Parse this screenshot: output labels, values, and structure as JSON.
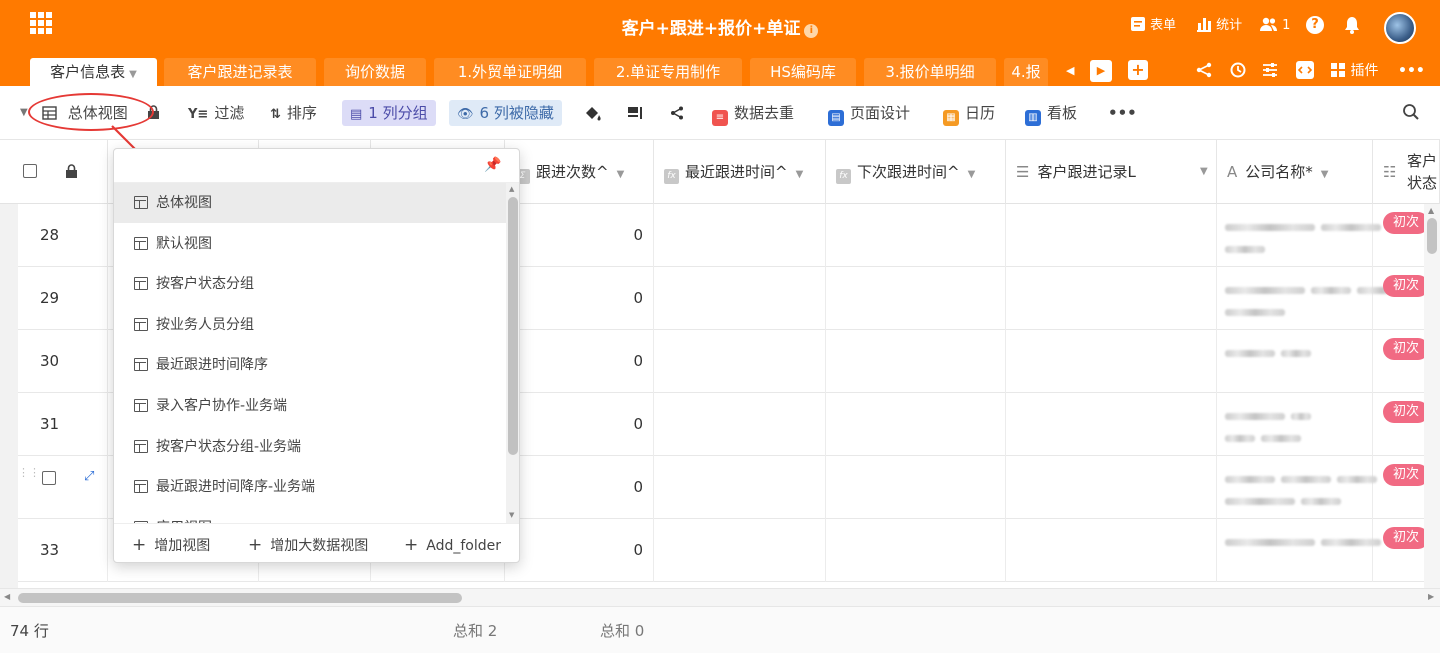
{
  "app": {
    "title": "客户+跟进+报价+单证",
    "info_icon": "info-icon"
  },
  "topright": {
    "form_label": "表单",
    "stats_label": "统计",
    "members_count": "1",
    "help": "?"
  },
  "tabs": [
    {
      "label": "客户信息表",
      "active": true
    },
    {
      "label": "客户跟进记录表"
    },
    {
      "label": "询价数据"
    },
    {
      "label": "1.外贸单证明细"
    },
    {
      "label": "2.单证专用制作"
    },
    {
      "label": "HS编码库"
    },
    {
      "label": "3.报价单明细"
    },
    {
      "label": "4.报"
    }
  ],
  "tab_tools": {
    "plugin_label": "插件",
    "more": "•••"
  },
  "toolbar": {
    "view_name": "总体视图",
    "filter": "过滤",
    "sort": "排序",
    "group": "1 列分组",
    "hidden": "6 列被隐藏",
    "dedupe": "数据去重",
    "page_design": "页面设计",
    "calendar": "日历",
    "kanban": "看板",
    "more": "•••"
  },
  "columns": {
    "follow_count": "跟进次数^",
    "last_follow": "最近跟进时间^",
    "next_follow": "下次跟进时间^",
    "record": "客户跟进记录L",
    "company": "公司名称*",
    "status_line1": "客户",
    "status_line2": "状态"
  },
  "rows": [
    {
      "no": "28",
      "count": "0",
      "status": "初次"
    },
    {
      "no": "29",
      "count": "0",
      "status": "初次"
    },
    {
      "no": "30",
      "count": "0",
      "status": "初次"
    },
    {
      "no": "31",
      "count": "0",
      "status": "初次"
    },
    {
      "no": "",
      "count": "0",
      "status": "初次"
    },
    {
      "no": "33",
      "count": "0",
      "status": "初次"
    }
  ],
  "view_menu": {
    "items": [
      "总体视图",
      "默认视图",
      "按客户状态分组",
      "按业务人员分组",
      "最近跟进时间降序",
      "录入客户协作-业务端",
      "按客户状态分组-业务端",
      "最近跟进时间降序-业务端",
      "应用视图"
    ],
    "add_view": "增加视图",
    "add_big_view": "增加大数据视图",
    "add_folder": "Add_folder"
  },
  "footer": {
    "row_count": "74 行",
    "sum1": "总和 2",
    "sum2": "总和 0"
  },
  "colors": {
    "brand": "#ff7a00",
    "badge": "#f16a83",
    "group_chip": "#dcdcf7",
    "hidden_chip": "#dfeaf7"
  }
}
